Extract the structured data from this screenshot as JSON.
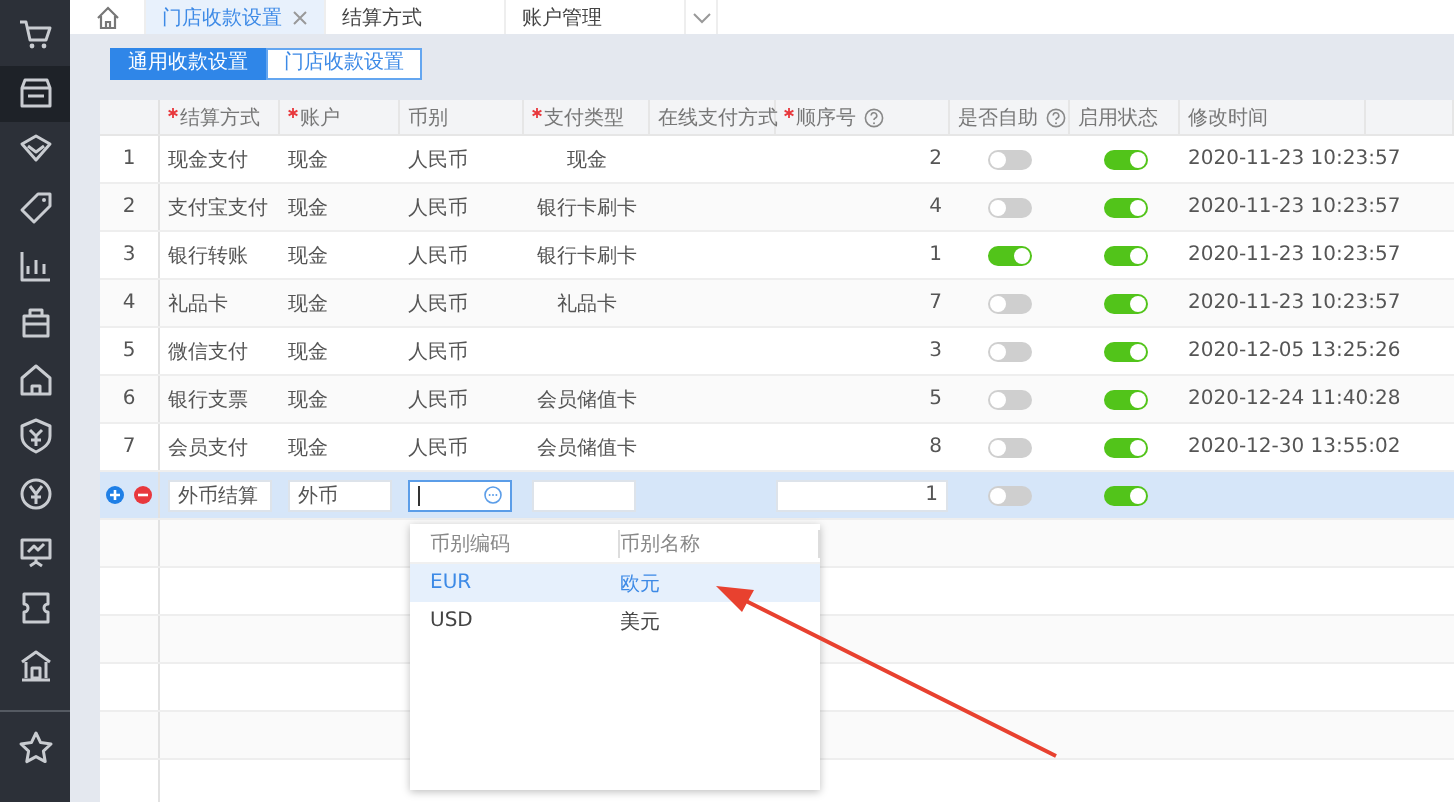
{
  "sidebar": {
    "items": [
      {
        "kind": "cart",
        "selected": false
      },
      {
        "kind": "store",
        "selected": true
      },
      {
        "kind": "diamond",
        "selected": false
      },
      {
        "kind": "tag",
        "selected": false
      },
      {
        "kind": "chart",
        "selected": false
      },
      {
        "kind": "bag",
        "selected": false
      },
      {
        "kind": "house",
        "selected": false
      },
      {
        "kind": "shield",
        "selected": false
      },
      {
        "kind": "coin",
        "selected": false
      },
      {
        "kind": "board",
        "selected": false
      },
      {
        "kind": "ticket",
        "selected": false
      },
      {
        "kind": "bank",
        "selected": false
      },
      {
        "kind": "star",
        "selected": false
      }
    ]
  },
  "tabs": [
    {
      "label": "门店收款设置",
      "selected": true,
      "closable": true
    },
    {
      "label": "结算方式",
      "selected": false,
      "closable": false
    },
    {
      "label": "账户管理",
      "selected": false,
      "closable": false
    }
  ],
  "subtabs": [
    {
      "label": "通用收款设置",
      "selected": true
    },
    {
      "label": "门店收款设置",
      "selected": false
    }
  ],
  "table": {
    "columns": [
      {
        "label": "结算方式",
        "required": true,
        "help": false
      },
      {
        "label": "账户",
        "required": true,
        "help": false
      },
      {
        "label": "币别",
        "required": false,
        "help": false
      },
      {
        "label": "支付类型",
        "required": true,
        "help": false
      },
      {
        "label": "在线支付方式",
        "required": false,
        "help": false
      },
      {
        "label": "顺序号",
        "required": true,
        "help": true
      },
      {
        "label": "是否自助",
        "required": false,
        "help": true
      },
      {
        "label": "启用状态",
        "required": false,
        "help": false
      },
      {
        "label": "修改时间",
        "required": false,
        "help": false
      }
    ],
    "rows": [
      {
        "no": "1",
        "method": "现金支付",
        "account": "现金",
        "currency": "人民币",
        "pay_type": "现金",
        "order": "2",
        "self_service": false,
        "enabled": true,
        "modified": "2020-11-23 10:23:57"
      },
      {
        "no": "2",
        "method": "支付宝支付",
        "account": "现金",
        "currency": "人民币",
        "pay_type": "银行卡刷卡",
        "order": "4",
        "self_service": false,
        "enabled": true,
        "modified": "2020-11-23 10:23:57"
      },
      {
        "no": "3",
        "method": "银行转账",
        "account": "现金",
        "currency": "人民币",
        "pay_type": "银行卡刷卡",
        "order": "1",
        "self_service": true,
        "enabled": true,
        "modified": "2020-11-23 10:23:57"
      },
      {
        "no": "4",
        "method": "礼品卡",
        "account": "现金",
        "currency": "人民币",
        "pay_type": "礼品卡",
        "order": "7",
        "self_service": false,
        "enabled": true,
        "modified": "2020-11-23 10:23:57"
      },
      {
        "no": "5",
        "method": "微信支付",
        "account": "现金",
        "currency": "人民币",
        "order": "3",
        "self_service": false,
        "enabled": true,
        "modified": "2020-12-05 13:25:26"
      },
      {
        "no": "6",
        "method": "银行支票",
        "account": "现金",
        "currency": "人民币",
        "pay_type": "会员储值卡",
        "order": "5",
        "self_service": false,
        "enabled": true,
        "modified": "2020-12-24 11:40:28"
      },
      {
        "no": "7",
        "method": "会员支付",
        "account": "现金",
        "currency": "人民币",
        "pay_type": "会员储值卡",
        "order": "8",
        "self_service": false,
        "enabled": true,
        "modified": "2020-12-30 13:55:02"
      }
    ],
    "edit_row": {
      "method": "外币结算",
      "account": "外币",
      "order": "1",
      "self_service": false,
      "enabled": true
    }
  },
  "dropdown": {
    "columns": [
      "币别编码",
      "币别名称"
    ],
    "options": [
      {
        "code": "EUR",
        "name": "欧元",
        "selected": true
      },
      {
        "code": "USD",
        "name": "美元",
        "selected": false
      }
    ]
  }
}
